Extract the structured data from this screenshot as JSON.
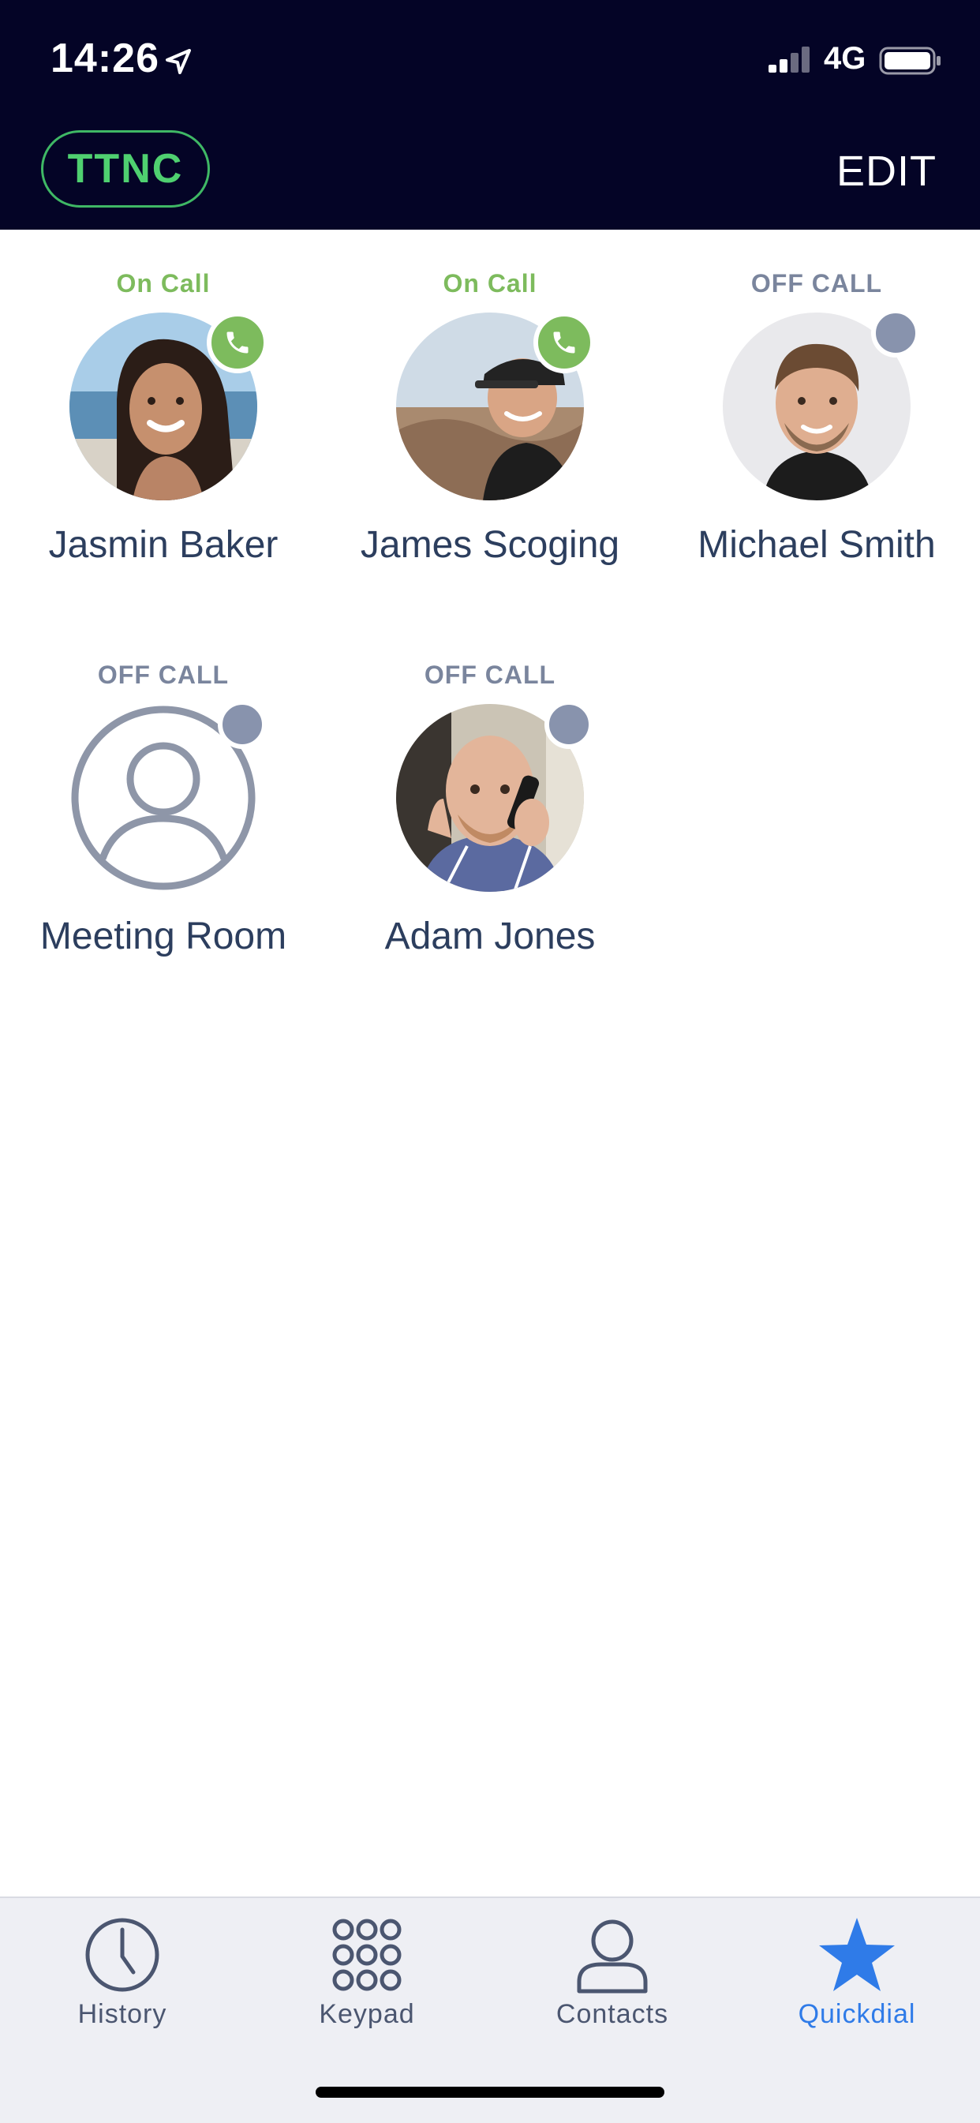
{
  "status_bar": {
    "time": "14:26",
    "network": "4G"
  },
  "header": {
    "org_badge": "TTNC",
    "edit_label": "EDIT"
  },
  "contacts": [
    {
      "name": "Jasmin Baker",
      "status": "On Call"
    },
    {
      "name": "James Scoging",
      "status": "On Call"
    },
    {
      "name": "Michael Smith",
      "status": "OFF CALL"
    },
    {
      "name": "Meeting Room",
      "status": "OFF CALL"
    },
    {
      "name": "Adam Jones",
      "status": "OFF CALL"
    }
  ],
  "tabs": [
    {
      "label": "History",
      "icon": "clock-icon",
      "active": false
    },
    {
      "label": "Keypad",
      "icon": "keypad-icon",
      "active": false
    },
    {
      "label": "Contacts",
      "icon": "person-icon",
      "active": false
    },
    {
      "label": "Quickdial",
      "icon": "star-icon",
      "active": true
    }
  ],
  "colors": {
    "header_bg": "#040426",
    "on_call": "#7dbb5d",
    "off_call": "#8893ad",
    "badge": "#4fd070",
    "active_tab": "#2f7be8"
  }
}
